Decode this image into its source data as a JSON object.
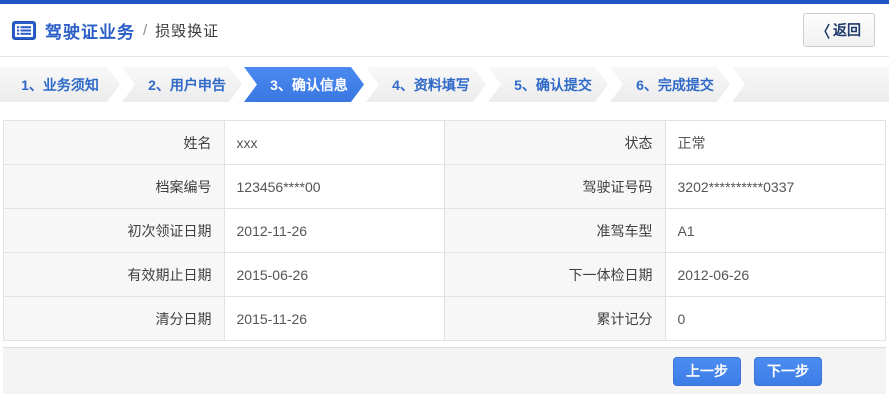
{
  "header": {
    "title": "驾驶证业务",
    "separator": "/",
    "subtitle": "损毁换证",
    "back_icon": "〈",
    "back_label": "返回"
  },
  "wizard": {
    "steps": [
      {
        "label": "1、业务须知",
        "active": false
      },
      {
        "label": "2、用户申告",
        "active": false
      },
      {
        "label": "3、确认信息",
        "active": true
      },
      {
        "label": "4、资料填写",
        "active": false
      },
      {
        "label": "5、确认提交",
        "active": false
      },
      {
        "label": "6、完成提交",
        "active": false
      }
    ]
  },
  "table": {
    "rows": [
      [
        {
          "label": "姓名",
          "value": "xxx"
        },
        {
          "label": "状态",
          "value": "正常"
        }
      ],
      [
        {
          "label": "档案编号",
          "value": "123456****00"
        },
        {
          "label": "驾驶证号码",
          "value": "3202**********0337"
        }
      ],
      [
        {
          "label": "初次领证日期",
          "value": "2012-11-26"
        },
        {
          "label": "准驾车型",
          "value": "A1"
        }
      ],
      [
        {
          "label": "有效期止日期",
          "value": "2015-06-26"
        },
        {
          "label": "下一体检日期",
          "value": "2012-06-26"
        }
      ],
      [
        {
          "label": "清分日期",
          "value": "2015-11-26"
        },
        {
          "label": "累计记分",
          "value": "0"
        }
      ]
    ]
  },
  "footer": {
    "prev_label": "上一步",
    "next_label": "下一步"
  },
  "colors": {
    "top_bar": "#1e55c5",
    "accent_blue": "#3d7ee0",
    "title_blue": "#2b5fc7",
    "step_text_blue": "#2f6ac8",
    "label_cell_bg": "#f7f7f7",
    "footer_bg": "#f4f4f4"
  }
}
